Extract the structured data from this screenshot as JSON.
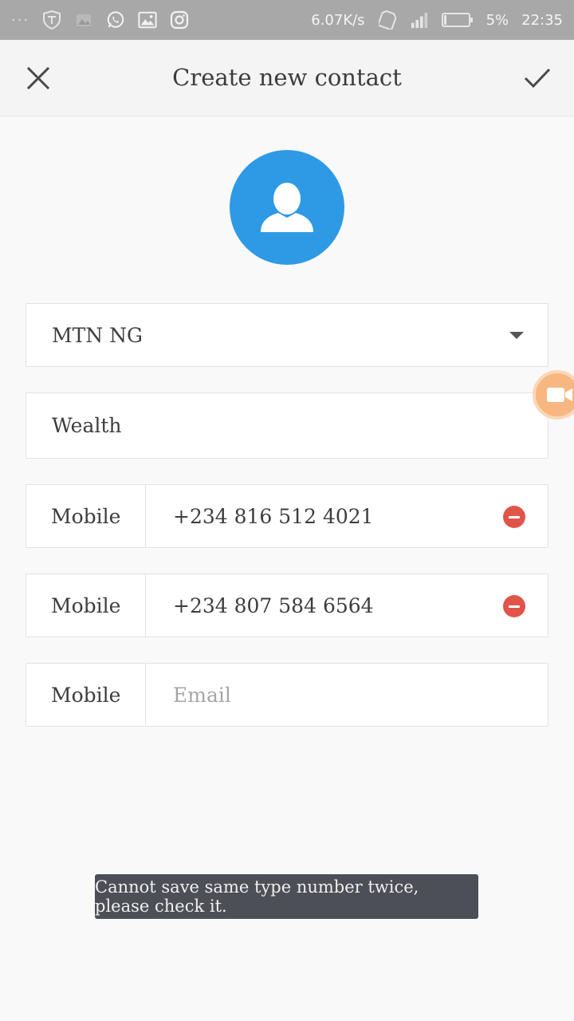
{
  "status_bar": {
    "network_speed": "6.07K/s",
    "battery": "5%",
    "time": "22:35"
  },
  "header": {
    "title": "Create new contact"
  },
  "form": {
    "account": "MTN NG",
    "name": "Wealth",
    "phones": [
      {
        "type": "Mobile",
        "number": "+234 816 512 4021"
      },
      {
        "type": "Mobile",
        "number": "+234 807 584 6564"
      }
    ],
    "email_row": {
      "type": "Mobile",
      "placeholder": "Email"
    }
  },
  "toast": {
    "message": "Cannot save same type number twice, please check it."
  },
  "colors": {
    "avatar": "#2e9ae6",
    "remove": "#e0554a",
    "toast_bg": "#4c4f55",
    "status_bar": "#a8a8a8"
  }
}
